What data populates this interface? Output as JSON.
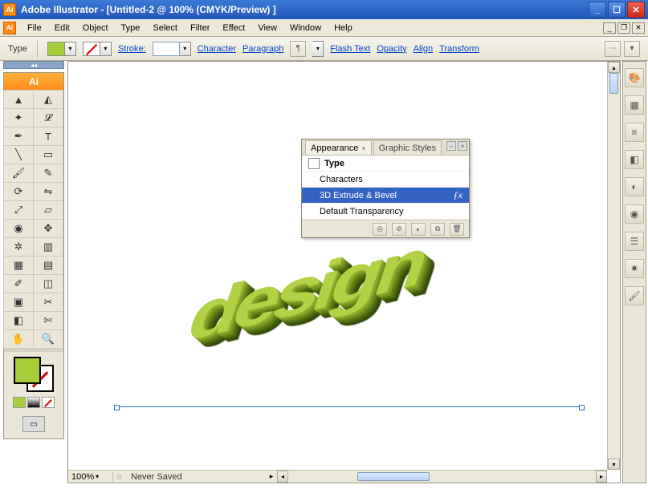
{
  "titlebar": {
    "app_icon_label": "Ai",
    "title": "Adobe Illustrator - [Untitled-2 @ 100% (CMYK/Preview) ]"
  },
  "menubar": {
    "items": [
      "File",
      "Edit",
      "Object",
      "Type",
      "Select",
      "Filter",
      "Effect",
      "View",
      "Window",
      "Help"
    ]
  },
  "optbar": {
    "tool_label": "Type",
    "stroke_label": "Stroke:",
    "links": {
      "character": "Character",
      "paragraph": "Paragraph",
      "flashtext": "Flash Text",
      "opacity": "Opacity",
      "align": "Align",
      "transform": "Transform"
    }
  },
  "toolspanel": {
    "header": "Ai"
  },
  "appearance": {
    "tab_appearance": "Appearance",
    "tab_graphicstyles": "Graphic Styles",
    "rows": {
      "type": "Type",
      "characters": "Characters",
      "extrude": "3D Extrude & Bevel",
      "transparency": "Default Transparency"
    }
  },
  "status": {
    "zoom": "100%",
    "text": "Never Saved"
  },
  "artwork": {
    "text": "design"
  },
  "colors": {
    "fill": "#a6ce39"
  }
}
